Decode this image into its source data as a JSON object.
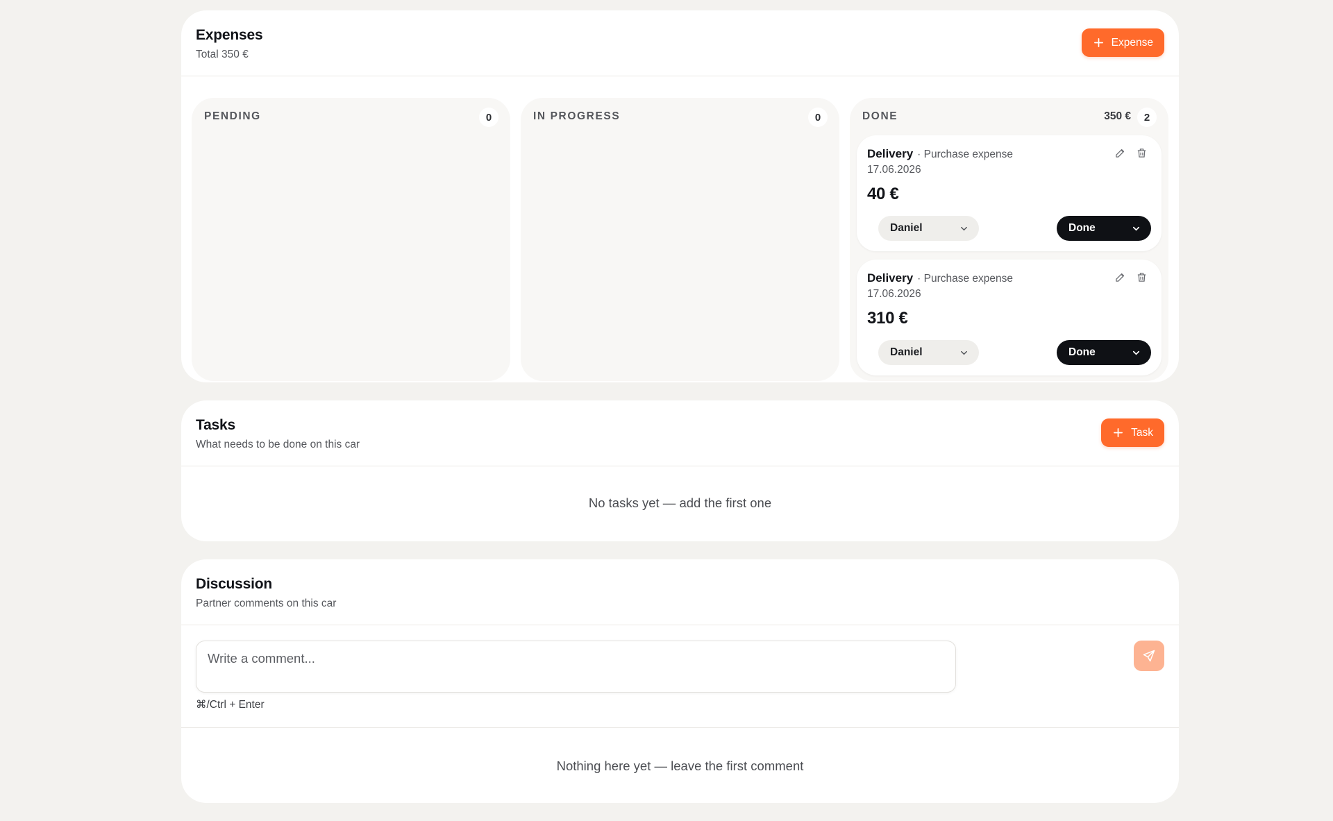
{
  "expenses": {
    "title": "Expenses",
    "subtitle": "Total 350 €",
    "add_button": "Expense",
    "columns": [
      {
        "title": "PENDING",
        "count": "0"
      },
      {
        "title": "IN PROGRESS",
        "count": "0"
      },
      {
        "title": "DONE",
        "total": "350 €",
        "count": "2"
      }
    ],
    "items": [
      {
        "name": "Delivery",
        "type": "· Purchase expense",
        "date": "17.06.2026",
        "amount": "40 €",
        "person": "Daniel",
        "status": "Done"
      },
      {
        "name": "Delivery",
        "type": "· Purchase expense",
        "date": "17.06.2026",
        "amount": "310 €",
        "person": "Daniel",
        "status": "Done"
      }
    ]
  },
  "tasks": {
    "title": "Tasks",
    "subtitle": "What needs to be done on this car",
    "add_button": "Task",
    "empty": "No tasks yet — add the first one"
  },
  "discussion": {
    "title": "Discussion",
    "subtitle": "Partner comments on this car",
    "placeholder": "Write a comment...",
    "hint": "⌘/Ctrl + Enter",
    "empty": "Nothing here yet — leave the first comment"
  },
  "colors": {
    "accent": "#ff6a2b",
    "accent_disabled": "#fdb392",
    "dark": "#0f1115",
    "background": "#f3f2ef"
  },
  "icons": [
    "plus-icon",
    "pencil-icon",
    "trash-icon",
    "chevron-down-icon",
    "send-icon"
  ]
}
